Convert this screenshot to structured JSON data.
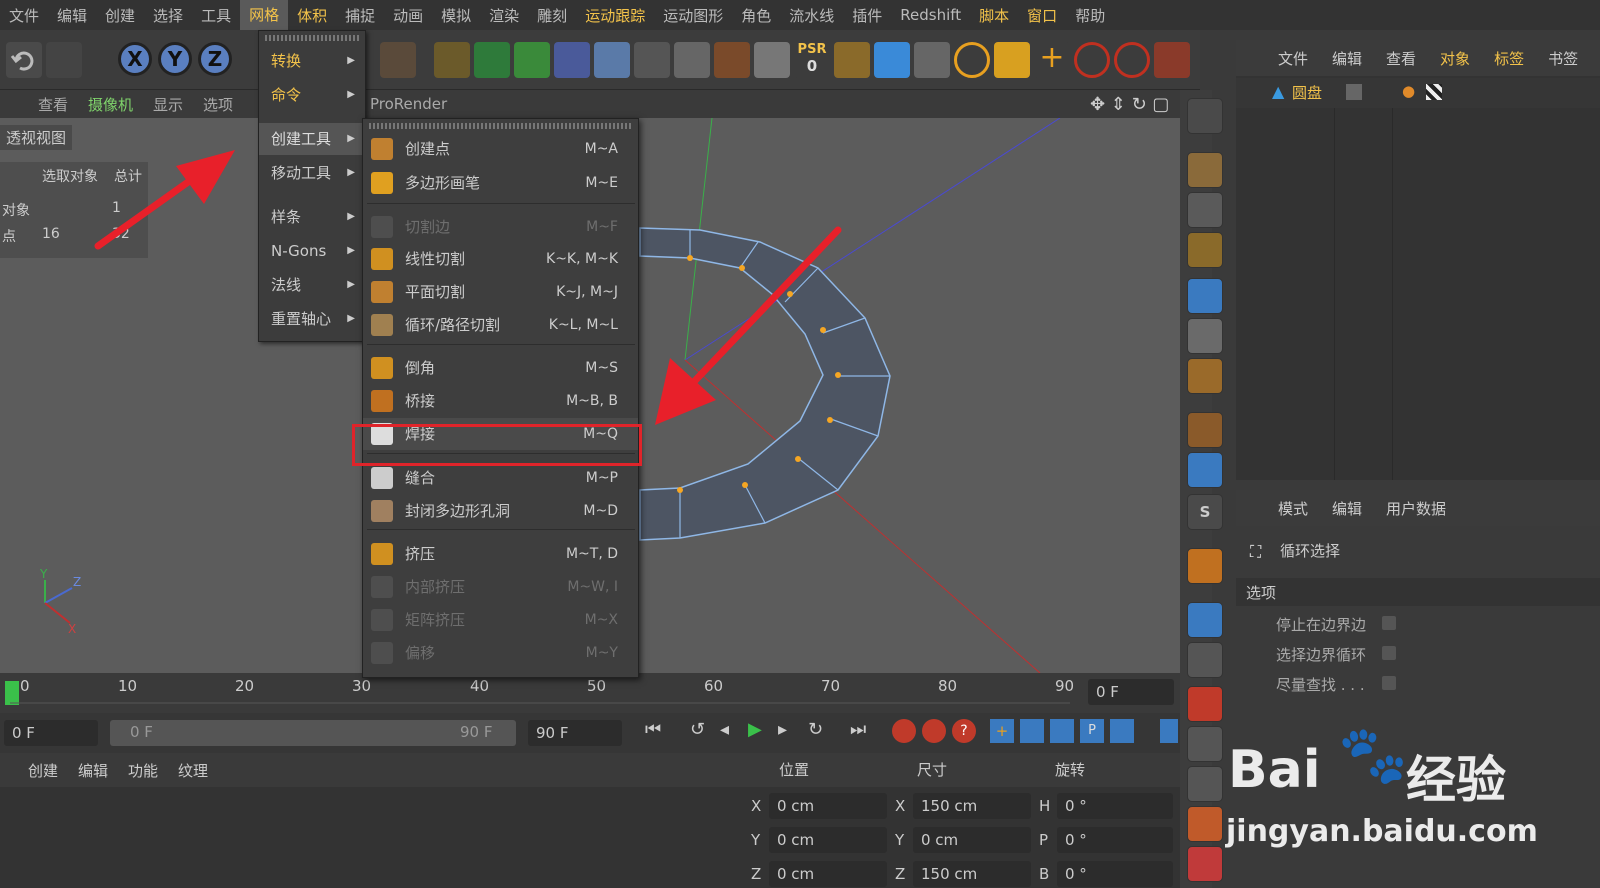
{
  "menubar": [
    "文件",
    "编辑",
    "创建",
    "选择",
    "工具",
    "网格",
    "体积",
    "捕捉",
    "动画",
    "模拟",
    "渲染",
    "雕刻",
    "运动跟踪",
    "运动图形",
    "角色",
    "流水线",
    "插件",
    "Redshift",
    "脚本",
    "窗口",
    "帮助"
  ],
  "menubar_active": "网格",
  "toolbar": {
    "axis_x": "X",
    "axis_y": "Y",
    "axis_z": "Z",
    "psr_label": "PSR",
    "psr_value": "0"
  },
  "viewport_menu": [
    "查看",
    "摄像机",
    "显示",
    "选项"
  ],
  "viewport_renderer": "ProRender",
  "viewport_label": "透视视图",
  "info": {
    "h1": "选取对象",
    "h2": "总计",
    "r1_label": "对象",
    "r1_total": "1",
    "r2_label": "点",
    "r2_sel": "16",
    "r2_total": "32"
  },
  "menu1": [
    {
      "label": "转换"
    },
    {
      "label": "命令"
    },
    {
      "label": "创建工具"
    },
    {
      "label": "移动工具"
    },
    {
      "label": "样条"
    },
    {
      "label": "N-Gons"
    },
    {
      "label": "法线"
    },
    {
      "label": "重置轴心"
    }
  ],
  "menu2": [
    {
      "label": "创建点",
      "shortcut": "M~A",
      "enabled": true
    },
    {
      "label": "多边形画笔",
      "shortcut": "M~E",
      "enabled": true
    },
    {
      "label": "切割边",
      "shortcut": "M~F",
      "enabled": false
    },
    {
      "label": "线性切割",
      "shortcut": "K~K, M~K",
      "enabled": true
    },
    {
      "label": "平面切割",
      "shortcut": "K~J, M~J",
      "enabled": true
    },
    {
      "label": "循环/路径切割",
      "shortcut": "K~L, M~L",
      "enabled": true
    },
    {
      "label": "倒角",
      "shortcut": "M~S",
      "enabled": true
    },
    {
      "label": "桥接",
      "shortcut": "M~B, B",
      "enabled": true
    },
    {
      "label": "焊接",
      "shortcut": "M~Q",
      "enabled": true
    },
    {
      "label": "缝合",
      "shortcut": "M~P",
      "enabled": true
    },
    {
      "label": "封闭多边形孔洞",
      "shortcut": "M~D",
      "enabled": true
    },
    {
      "label": "挤压",
      "shortcut": "M~T, D",
      "enabled": true
    },
    {
      "label": "内部挤压",
      "shortcut": "M~W, I",
      "enabled": false
    },
    {
      "label": "矩阵挤压",
      "shortcut": "M~X",
      "enabled": false
    },
    {
      "label": "偏移",
      "shortcut": "M~Y",
      "enabled": false
    }
  ],
  "object_manager": {
    "tabs": [
      "文件",
      "编辑",
      "查看",
      "对象",
      "标签",
      "书签"
    ],
    "object_name": "圆盘"
  },
  "attributes": {
    "tabs": [
      "模式",
      "编辑",
      "用户数据"
    ],
    "tool": "循环选择",
    "section": "选项",
    "options": [
      "停止在边界边",
      "选择边界循环",
      "尽量查找 . . ."
    ]
  },
  "timeline": {
    "ticks": [
      "0",
      "10",
      "20",
      "30",
      "40",
      "50",
      "60",
      "70",
      "80",
      "90"
    ],
    "current_frame": "0 F"
  },
  "transport": {
    "start": "0 F",
    "range_start": "0 F",
    "range_end": "90 F",
    "end": "90 F"
  },
  "bottom_tabs": [
    "创建",
    "编辑",
    "功能",
    "纹理"
  ],
  "coords": {
    "headers": [
      "位置",
      "尺寸",
      "旋转"
    ],
    "pos": [
      {
        "axis": "X",
        "value": "0 cm"
      },
      {
        "axis": "Y",
        "value": "0 cm"
      },
      {
        "axis": "Z",
        "value": "0 cm"
      }
    ],
    "size": [
      {
        "axis": "X",
        "value": "150 cm"
      },
      {
        "axis": "Y",
        "value": "0 cm"
      },
      {
        "axis": "Z",
        "value": "150 cm"
      }
    ],
    "rot": [
      {
        "axis": "H",
        "value": "0 °"
      },
      {
        "axis": "P",
        "value": "0 °"
      },
      {
        "axis": "B",
        "value": "0 °"
      }
    ]
  },
  "watermark": {
    "brand": "Bai",
    "brand2": "经验",
    "url": "jingyan.baidu.com"
  },
  "colors": {
    "accent": "#f2c24a",
    "highlight_box": "#e0242a",
    "arrow": "#e8202a",
    "mesh": "#4d5563",
    "mesh_edge": "#8fb7e6",
    "vertex": "#f5a623"
  }
}
